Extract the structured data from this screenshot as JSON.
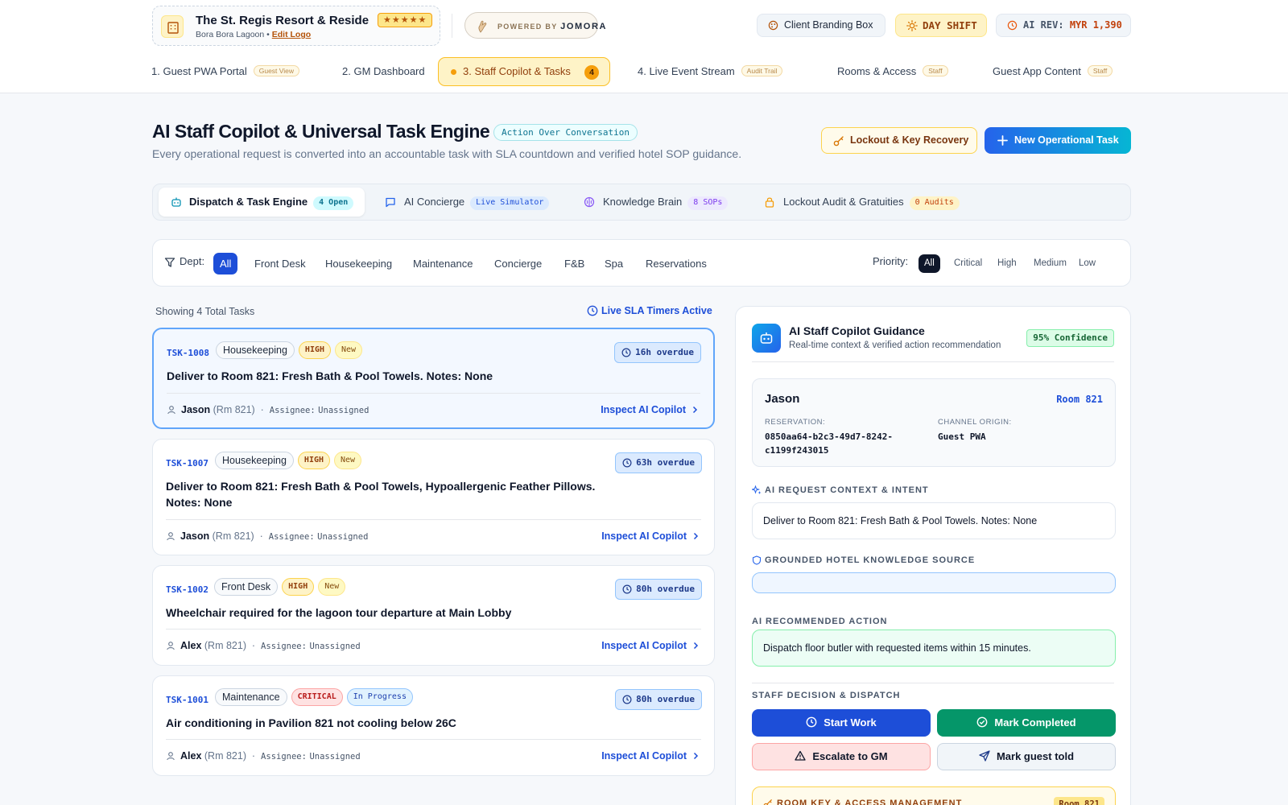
{
  "hotel": {
    "name": "The St. Regis Resort & Residen...",
    "stars": "★★★★★",
    "location": "Bora Bora Lagoon",
    "separator": "•",
    "edit_logo": "Edit Logo"
  },
  "powered_by": {
    "label": "POWERED BY",
    "brand": "JOMORA"
  },
  "top_chips": {
    "branding": "Client Branding Box",
    "shift": "DAY SHIFT",
    "rev_label": "AI REV:",
    "rev_value": "MYR 1,390"
  },
  "nav": {
    "items": [
      {
        "label": "1. Guest PWA Portal",
        "tag": "Guest View"
      },
      {
        "label": "2. GM Dashboard",
        "tag": ""
      },
      {
        "label": "3. Staff Copilot & Tasks",
        "count": "4"
      },
      {
        "label": "4. Live Event Stream",
        "tag": "Audit Trail"
      },
      {
        "label": "Rooms & Access",
        "tag": "Staff"
      },
      {
        "label": "Guest App Content",
        "tag": "Staff"
      }
    ]
  },
  "header": {
    "title": "AI Staff Copilot & Universal Task Engine",
    "badge": "Action Over Conversation",
    "subtitle": "Every operational request is converted into an accountable task with SLA countdown and verified hotel SOP guidance.",
    "lockout_button": "Lockout & Key Recovery",
    "new_task_button": "New Operational Task"
  },
  "tabs": [
    {
      "label": "Dispatch & Task Engine",
      "badge": "4 Open",
      "color": "#0891b2"
    },
    {
      "label": "AI Concierge",
      "badge": "Live Simulator",
      "color": "#2563eb"
    },
    {
      "label": "Knowledge Brain",
      "badge": "8 SOPs",
      "color": "#8b5cf6"
    },
    {
      "label": "Lockout Audit & Gratuities",
      "badge": "0 Audits",
      "color": "#f59e0b"
    }
  ],
  "filters": {
    "dept_label": "Dept:",
    "departments": [
      "All",
      "Front Desk",
      "Housekeeping",
      "Maintenance",
      "Concierge",
      "F&B",
      "Spa",
      "Reservations"
    ],
    "priority_label": "Priority:",
    "priorities": [
      "All",
      "Critical",
      "High",
      "Medium",
      "Low"
    ]
  },
  "list": {
    "showing": "Showing 4 Total Tasks",
    "live_sla": "Live SLA Timers Active",
    "inspect_label": "Inspect AI Copilot",
    "assignee_label": "Assignee:",
    "tasks": [
      {
        "id": "TSK-1008",
        "dept": "Housekeeping",
        "priority": "HIGH",
        "status": "New",
        "overdue": "16h overdue",
        "title": "Deliver to Room 821: Fresh Bath & Pool Towels. Notes: None",
        "guest": "Jason",
        "room": "(Rm 821)",
        "assignee": "Unassigned"
      },
      {
        "id": "TSK-1007",
        "dept": "Housekeeping",
        "priority": "HIGH",
        "status": "New",
        "overdue": "63h overdue",
        "title": "Deliver to Room 821: Fresh Bath & Pool Towels, Hypoallergenic Feather Pillows. Notes: None",
        "guest": "Jason",
        "room": "(Rm 821)",
        "assignee": "Unassigned"
      },
      {
        "id": "TSK-1002",
        "dept": "Front Desk",
        "priority": "HIGH",
        "status": "New",
        "overdue": "80h overdue",
        "title": "Wheelchair required for the lagoon tour departure at Main Lobby",
        "guest": "Alex",
        "room": "(Rm 821)",
        "assignee": "Unassigned"
      },
      {
        "id": "TSK-1001",
        "dept": "Maintenance",
        "priority": "CRITICAL",
        "status": "In Progress",
        "overdue": "80h overdue",
        "title": "Air conditioning in Pavilion 821 not cooling below 26C",
        "guest": "Alex",
        "room": "(Rm 821)",
        "assignee": "Unassigned"
      }
    ]
  },
  "copilot": {
    "title": "AI Staff Copilot Guidance",
    "subtitle": "Real-time context & verified action recommendation",
    "confidence": "95% Confidence",
    "guest_name": "Jason",
    "room": "Room 821",
    "reservation_label": "RESERVATION:",
    "reservation_value": "0850aa64-b2c3-49d7-8242-c1199f243015",
    "channel_label": "CHANNEL ORIGIN:",
    "channel_value": "Guest PWA",
    "context_heading": "AI REQUEST CONTEXT & INTENT",
    "context_text": "Deliver to Room 821: Fresh Bath & Pool Towels. Notes: None",
    "knowledge_heading": "GROUNDED HOTEL KNOWLEDGE SOURCE",
    "knowledge_text": "",
    "action_heading": "AI RECOMMENDED ACTION",
    "action_text": "Dispatch floor butler with requested items within 15 minutes.",
    "decision_heading": "STAFF DECISION & DISPATCH",
    "buttons": {
      "start": "Start Work",
      "complete": "Mark Completed",
      "escalate": "Escalate to GM",
      "told": "Mark guest told"
    },
    "key_heading": "ROOM KEY & ACCESS MANAGEMENT",
    "key_room": "Room 821"
  },
  "colors": {
    "primary": "#1d4ed8",
    "accent_amber": "#f59e0b",
    "success": "#059669",
    "danger": "#b91c1c"
  }
}
